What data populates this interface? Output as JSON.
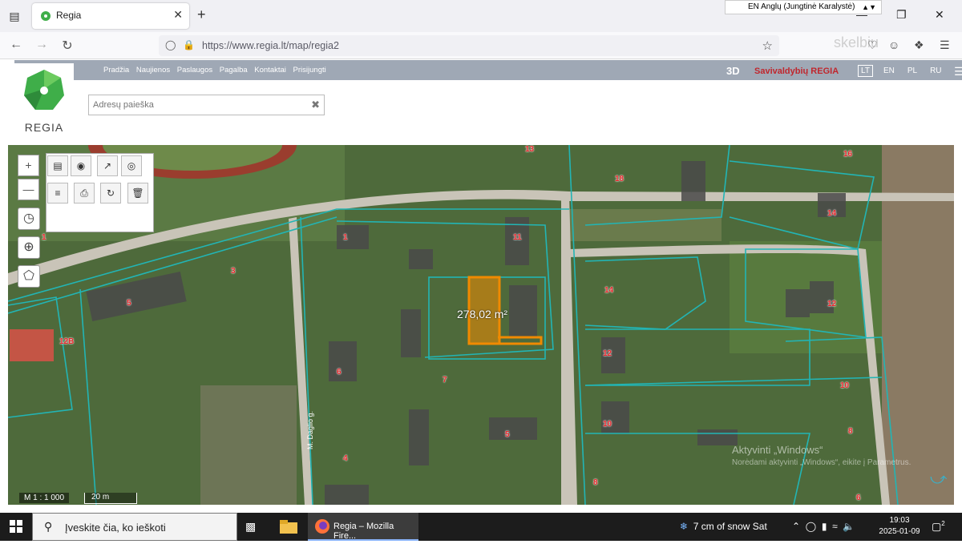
{
  "browser": {
    "tab_title": "Regia",
    "url": "https://www.regia.lt/map/regia2",
    "language_selector": "EN Anglų (Jungtinė Karalystė)",
    "watermark_brand": "skelbiu"
  },
  "site": {
    "logo_name": "REGIA",
    "nav": [
      "Pradžia",
      "Naujienos",
      "Paslaugos",
      "Pagalba",
      "Kontaktai",
      "Prisijungti"
    ],
    "three_d": "3D",
    "municipality": "Savivaldybių REGIA",
    "languages": [
      "LT",
      "EN",
      "PL",
      "RU"
    ],
    "active_language": "LT",
    "search_placeholder": "Adresų paieška"
  },
  "map": {
    "selected_area": "278,02 m²",
    "scale": "M 1 : 1 000",
    "scale_bar": "20 m",
    "street_label": "M. Daglio g.",
    "windows_watermark_line1": "Aktyvinti „Windows“",
    "windows_watermark_line2": "Norėdami aktyvinti „Windows“, eikite į Parametrus.",
    "parcel_labels": [
      "1",
      "3",
      "5",
      "12B",
      "11",
      "14",
      "1",
      "6",
      "7",
      "4",
      "5",
      "13",
      "16",
      "18",
      "14",
      "12",
      "12",
      "10",
      "10",
      "8",
      "8",
      "6"
    ]
  },
  "colors": {
    "parcel_outline": "#22b5b5",
    "selected_parcel": "#f08a00",
    "label_red": "#e8252a",
    "header_strip": "#9fa8b5"
  },
  "taskbar": {
    "search_placeholder": "Įveskite čia, ko ieškoti",
    "firefox_label": "Regia – Mozilla Fire...",
    "weather": "7 cm of snow Sat",
    "time": "19:03",
    "date": "2025-01-09",
    "notification_count": "2"
  }
}
